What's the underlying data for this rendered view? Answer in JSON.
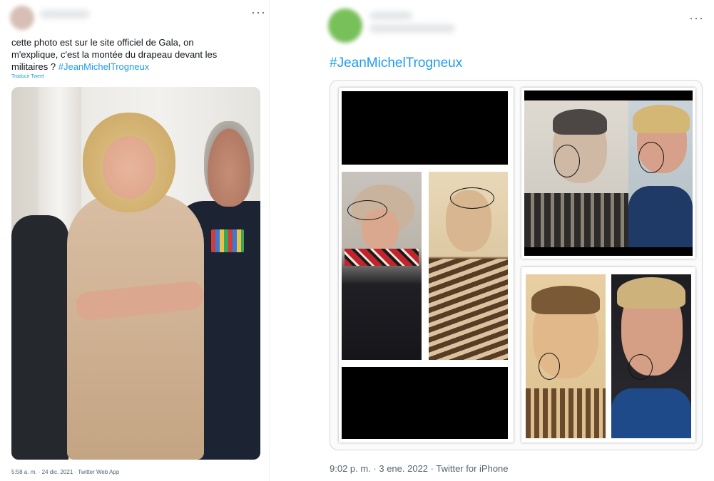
{
  "left_tweet": {
    "text_line1": "cette photo est sur le site officiel de Gala, on",
    "text_line2": "m'explique, c'est la montée du drapeau devant les",
    "text_line3": "militaires  ? ",
    "hashtag": "#JeanMichelTrogneux",
    "translate_label": "Traducir Tweet",
    "meta": "5:58 a. m. · 24 dic. 2021 · Twitter Web App",
    "more_label": "···"
  },
  "right_tweet": {
    "hashtag": "#JeanMichelTrogneux",
    "meta": "9:02 p. m. · 3 ene. 2022 · Twitter for iPhone",
    "more_label": "···"
  },
  "colors": {
    "accent": "#1d9bf0",
    "text": "#0f1419",
    "muted": "#536471",
    "avatar_left": "#d9c4bd",
    "avatar_right": "#7dc25f"
  }
}
